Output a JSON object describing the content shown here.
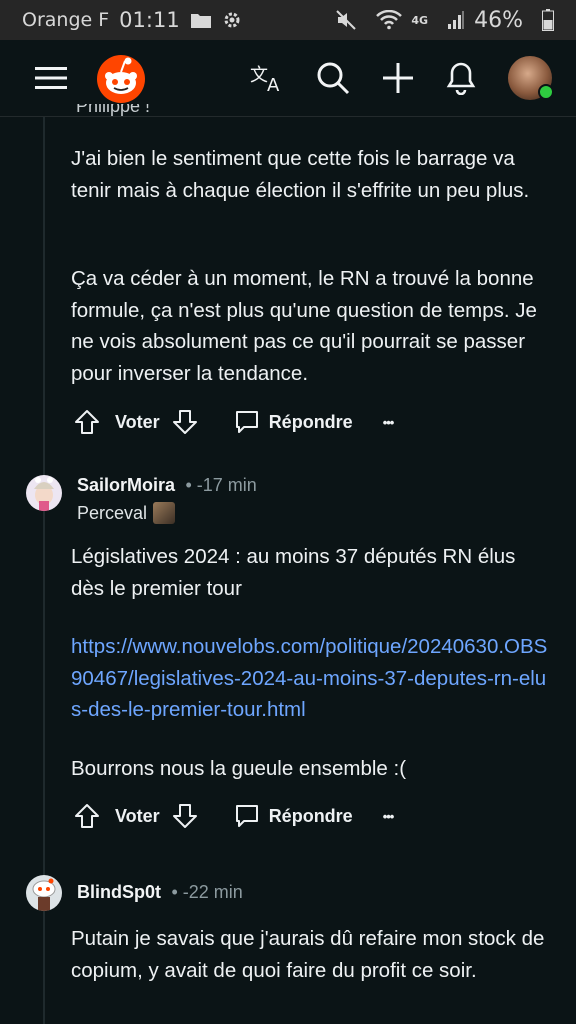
{
  "status_bar": {
    "carrier": "Orange F",
    "time": "01:11",
    "network": "4G",
    "battery": "46%"
  },
  "app_bar": {
    "icons": [
      "menu-icon",
      "reddit-logo",
      "translate-icon",
      "search-icon",
      "plus-icon",
      "bell-icon",
      "avatar"
    ]
  },
  "partial_comment": {
    "author_fragment": "Philippe !",
    "paragraphs": [
      "J'ai bien le sentiment que cette fois le barrage va tenir mais à chaque élection il s'effrite un peu plus.",
      "Ça va céder à un moment, le RN a trouvé la bonne formule, ça n'est plus qu'une question de temps. Je ne vois absolument pas ce qu'il pourrait se passer pour inverser la tendance."
    ],
    "vote_label": "Voter",
    "reply_label": "Répondre",
    "more_label": "•••"
  },
  "comments": [
    {
      "author": "SailorMoira",
      "time": "• -17 min",
      "flair": "Perceval",
      "text": "Législatives 2024 : au moins 37 députés RN élus dès le premier tour",
      "link": "https://www.nouvelobs.com/politique/20240630.OBS90467/legislatives-2024-au-moins-37-deputes-rn-elus-des-le-premier-tour.html",
      "text2": "Bourrons nous la gueule ensemble :(",
      "vote_label": "Voter",
      "reply_label": "Répondre",
      "more_label": "•••"
    },
    {
      "author": "BlindSp0t",
      "time": "• -22 min",
      "text": "Putain je savais que j'aurais dû refaire mon stock de copium, y avait de quoi faire du profit ce soir."
    }
  ],
  "colors": {
    "background": "#0b1416",
    "status_bar": "#262626",
    "link": "#6ea6ff",
    "reddit_orange": "#ff4500",
    "muted_text": "#8c9a9f"
  }
}
